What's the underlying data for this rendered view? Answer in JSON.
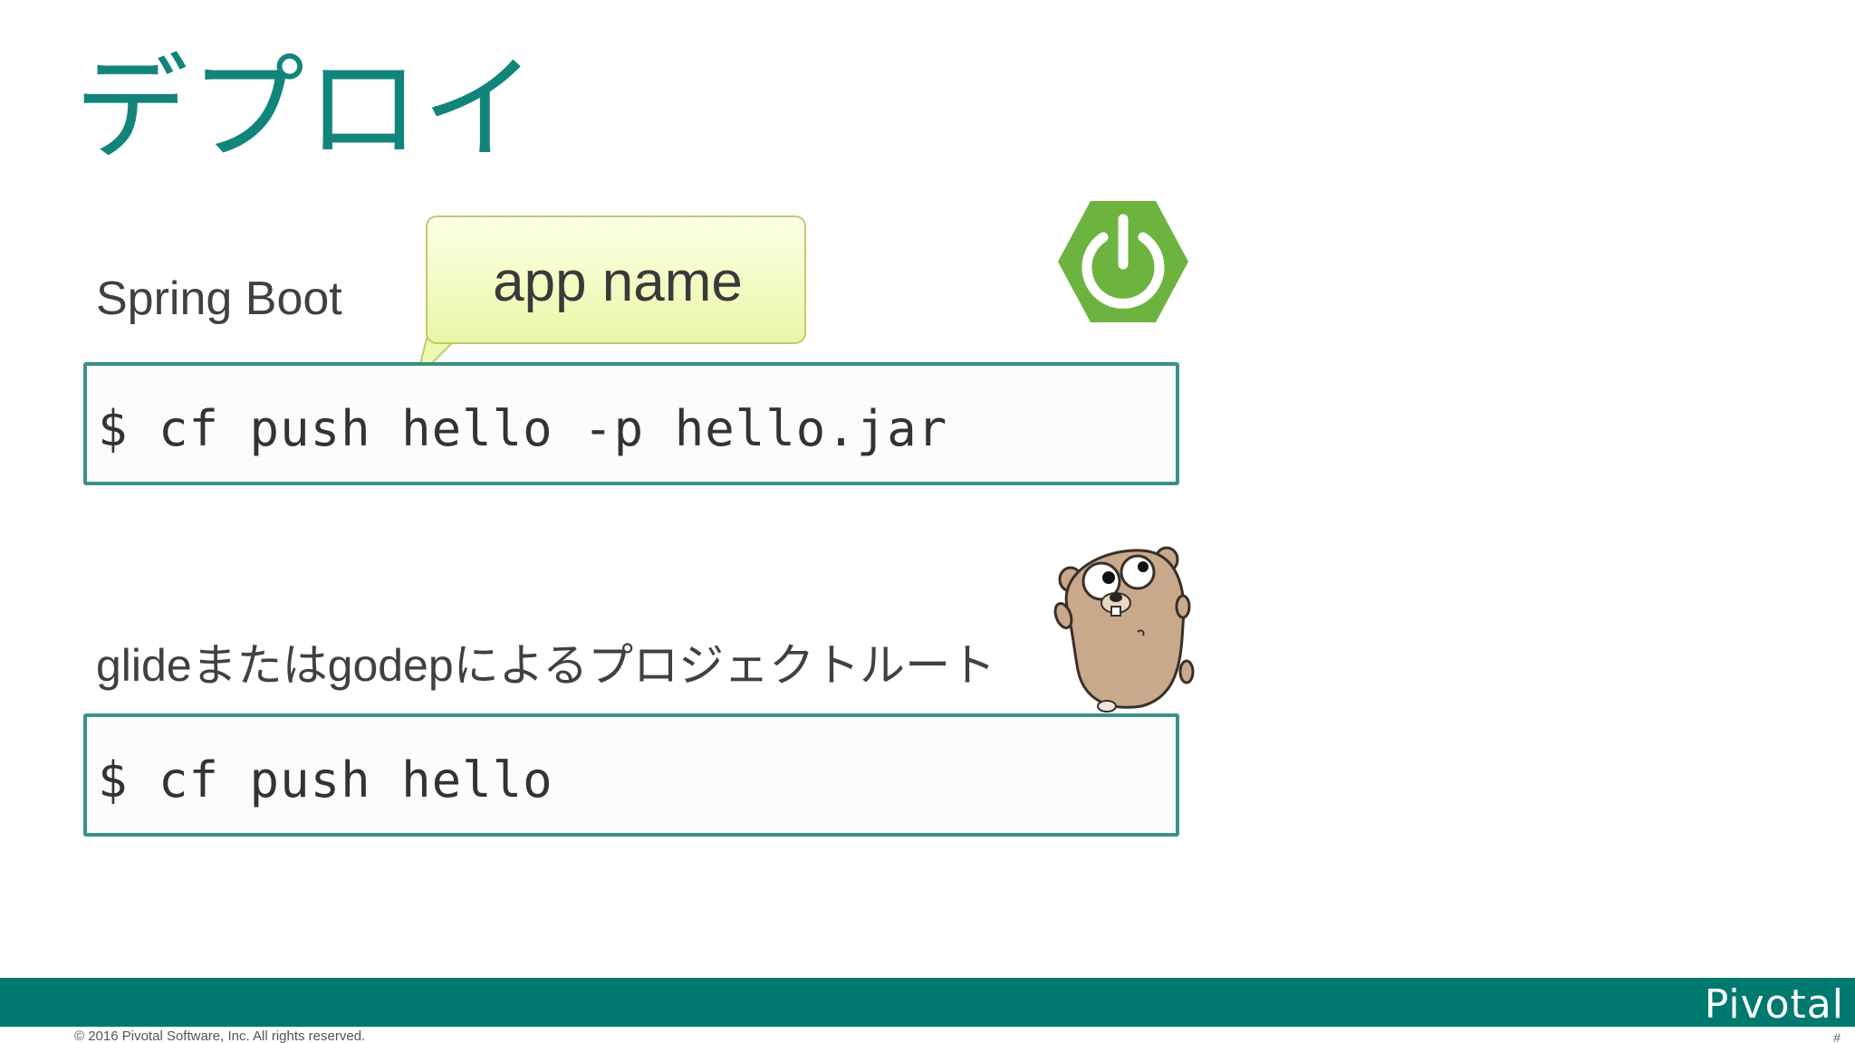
{
  "slide": {
    "title": "デプロイ",
    "spring_section": {
      "label": "Spring Boot",
      "command": "$ cf push hello -p hello.jar"
    },
    "callout": {
      "text": "app name"
    },
    "go_section": {
      "label": "glideまたはgodepによるプロジェクトルート",
      "command": "$ cf push hello"
    },
    "icons": {
      "spring": "spring-boot-power-icon",
      "go": "go-gopher-mascot"
    },
    "footer": {
      "brand": "Pivotal",
      "copyright": "© 2016 Pivotal Software, Inc.  All rights reserved.",
      "page_marker": "#"
    },
    "colors": {
      "accent": "#12857a",
      "footer_bar": "#00796e",
      "code_border": "#3a9189",
      "spring_green": "#6db33f",
      "gopher_brown": "#c9a98c",
      "callout_fill": "#f3fbc3"
    }
  }
}
